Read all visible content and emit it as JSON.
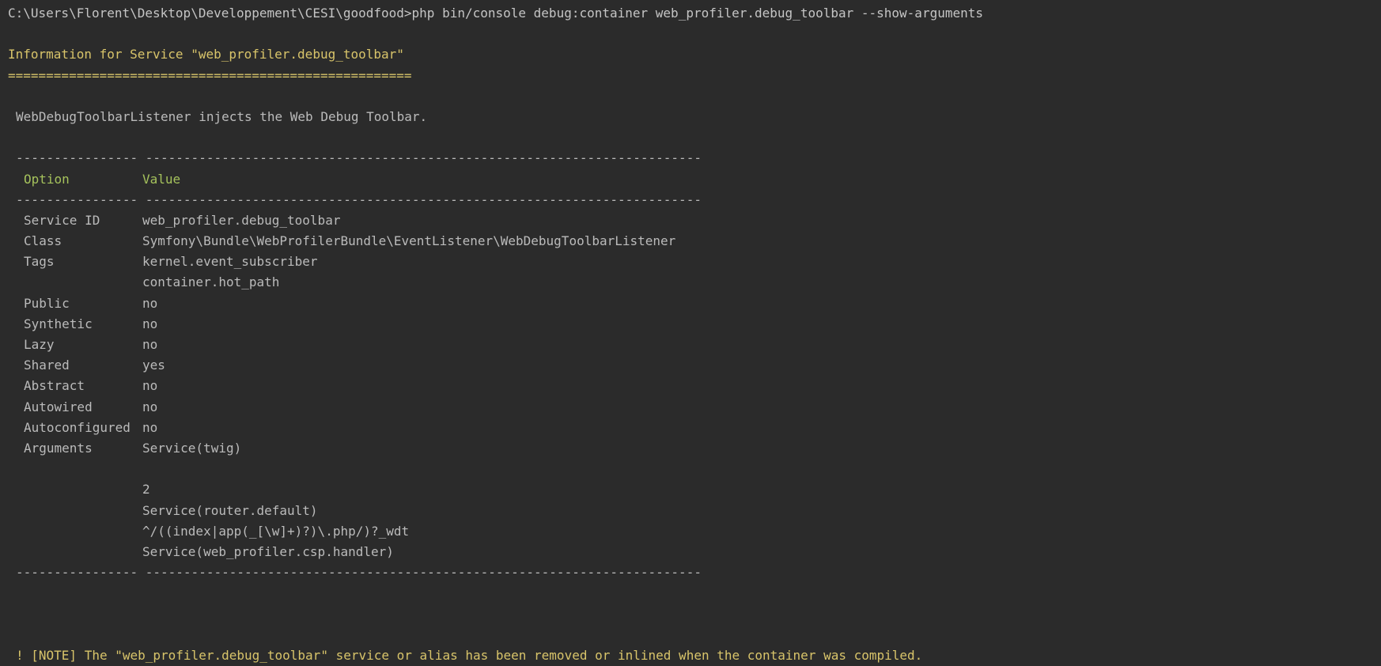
{
  "command": "C:\\Users\\Florent\\Desktop\\Developpement\\CESI\\goodfood>php bin/console debug:container web_profiler.debug_toolbar --show-arguments",
  "heading": "Information for Service \"web_profiler.debug_toolbar\"",
  "heading_underline": "=====================================================",
  "description": "WebDebugToolbarListener injects the Web Debug Toolbar.",
  "separator": "---------------- -------------------------------------------------------------------------",
  "table": {
    "header": {
      "option": "Option",
      "value": "Value"
    },
    "rows": [
      {
        "option": "Service ID",
        "value": "web_profiler.debug_toolbar"
      },
      {
        "option": "Class",
        "value": "Symfony\\Bundle\\WebProfilerBundle\\EventListener\\WebDebugToolbarListener"
      },
      {
        "option": "Tags",
        "value": "kernel.event_subscriber"
      },
      {
        "option": "",
        "value": "container.hot_path"
      },
      {
        "option": "Public",
        "value": "no"
      },
      {
        "option": "Synthetic",
        "value": "no"
      },
      {
        "option": "Lazy",
        "value": "no"
      },
      {
        "option": "Shared",
        "value": "yes"
      },
      {
        "option": "Abstract",
        "value": "no"
      },
      {
        "option": "Autowired",
        "value": "no"
      },
      {
        "option": "Autoconfigured",
        "value": "no"
      },
      {
        "option": "Arguments",
        "value": "Service(twig)"
      },
      {
        "option": "",
        "value": ""
      },
      {
        "option": "",
        "value": "2"
      },
      {
        "option": "",
        "value": "Service(router.default)"
      },
      {
        "option": "",
        "value": "^/((index|app(_[\\w]+)?)\\.php/)?_wdt"
      },
      {
        "option": "",
        "value": "Service(web_profiler.csp.handler)"
      }
    ]
  },
  "note": "! [NOTE] The \"web_profiler.debug_toolbar\" service or alias has been removed or inlined when the container was compiled.",
  "colors": {
    "background": "#2b2b2b",
    "text": "#bbbbbb",
    "heading": "#d8c46a",
    "table_header": "#a5c25c"
  }
}
